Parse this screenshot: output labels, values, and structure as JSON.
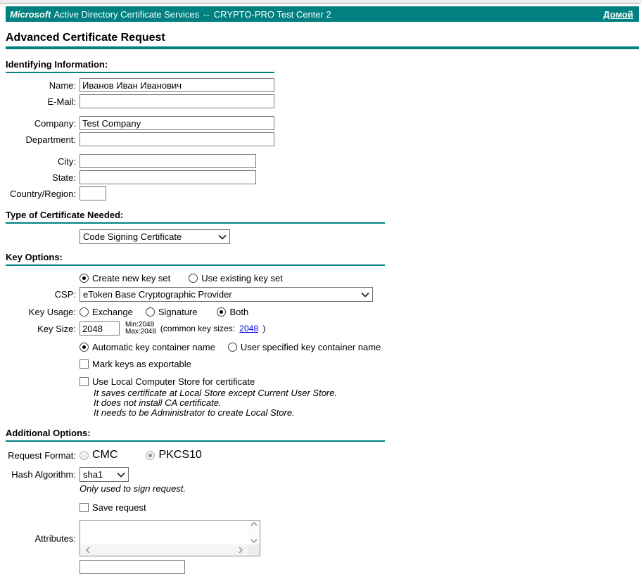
{
  "banner": {
    "brand": "Microsoft",
    "product": "Active Directory Certificate Services",
    "separator": "--",
    "ca_name": "CRYPTO-PRO Test Center 2",
    "home_link": "Домой",
    "bg_color": "#008080"
  },
  "page": {
    "title": "Advanced Certificate Request"
  },
  "identifying": {
    "heading": "Identifying Information:",
    "fields": [
      {
        "label": "Name:",
        "value": "Иванов Иван Иванович"
      },
      {
        "label": "E-Mail:",
        "value": ""
      },
      {
        "label": "Company:",
        "value": "Test Company"
      },
      {
        "label": "Department:",
        "value": ""
      },
      {
        "label": "City:",
        "value": ""
      },
      {
        "label": "State:",
        "value": ""
      },
      {
        "label": "Country/Region:",
        "value": ""
      }
    ]
  },
  "cert_type": {
    "heading": "Type of Certificate Needed:",
    "selected": "Code Signing Certificate"
  },
  "key_options": {
    "heading": "Key Options:",
    "key_set": {
      "create": "Create new key set",
      "existing": "Use existing key set",
      "selected": "Create new key set"
    },
    "csp": {
      "label": "CSP:",
      "value": "eToken Base Cryptographic Provider"
    },
    "key_usage": {
      "label": "Key Usage:",
      "options": [
        "Exchange",
        "Signature",
        "Both"
      ],
      "selected": "Both"
    },
    "key_size": {
      "label": "Key Size:",
      "value": "2048",
      "min": "Min:2048",
      "max": "Max:2048",
      "common_prefix": "(common key sizes:",
      "common_link": "2048",
      "common_suffix": ")"
    },
    "container": {
      "auto": "Automatic key container name",
      "user": "User specified key container name",
      "selected": "Automatic key container name"
    },
    "exportable": "Mark keys as exportable",
    "local_store": "Use Local Computer Store for certificate",
    "local_store_notes": [
      "It saves certificate at Local Store except Current User Store.",
      "It does not install CA certificate.",
      "It needs to be Administrator to create Local Store."
    ]
  },
  "additional": {
    "heading": "Additional Options:",
    "request_format": {
      "label": "Request Format:",
      "options": [
        "CMC",
        "PKCS10"
      ],
      "selected": "PKCS10",
      "disabled": true
    },
    "hash": {
      "label": "Hash Algorithm:",
      "value": "sha1",
      "note": "Only used to sign request."
    },
    "save_request": "Save request",
    "attributes_label": "Attributes:"
  },
  "colors": {
    "accent_teal": "#008080",
    "link_blue": "#0000EE"
  }
}
